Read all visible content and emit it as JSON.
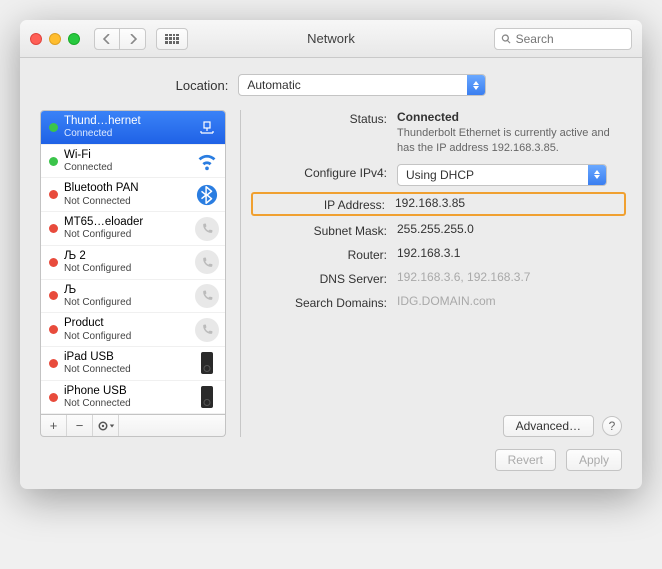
{
  "window": {
    "title": "Network"
  },
  "search": {
    "placeholder": "Search"
  },
  "location": {
    "label": "Location:",
    "value": "Automatic"
  },
  "sidebar": {
    "items": [
      {
        "name": "Thund…hernet",
        "sub": "Connected",
        "status": "green",
        "icon": "ethernet",
        "selected": true
      },
      {
        "name": "Wi-Fi",
        "sub": "Connected",
        "status": "green",
        "icon": "wifi"
      },
      {
        "name": "Bluetooth PAN",
        "sub": "Not Connected",
        "status": "red",
        "icon": "bluetooth"
      },
      {
        "name": "MT65…eloader",
        "sub": "Not Configured",
        "status": "red",
        "icon": "handset"
      },
      {
        "name": "Љ 2",
        "sub": "Not Configured",
        "status": "red",
        "icon": "handset"
      },
      {
        "name": "Љ",
        "sub": "Not Configured",
        "status": "red",
        "icon": "handset"
      },
      {
        "name": "Product",
        "sub": "Not Configured",
        "status": "red",
        "icon": "handset"
      },
      {
        "name": "iPad USB",
        "sub": "Not Connected",
        "status": "red",
        "icon": "slab"
      },
      {
        "name": "iPhone USB",
        "sub": "Not Connected",
        "status": "red",
        "icon": "slab"
      }
    ]
  },
  "detail": {
    "status_label": "Status:",
    "status_value": "Connected",
    "status_desc": "Thunderbolt Ethernet is currently active and has the IP address 192.168.3.85.",
    "cfg_label": "Configure IPv4:",
    "cfg_value": "Using DHCP",
    "ip_label": "IP Address:",
    "ip_value": "192.168.3.85",
    "mask_label": "Subnet Mask:",
    "mask_value": "255.255.255.0",
    "router_label": "Router:",
    "router_value": "192.168.3.1",
    "dns_label": "DNS Server:",
    "dns_value": "192.168.3.6, 192.168.3.7",
    "sd_label": "Search Domains:",
    "sd_value": "IDG.DOMAIN.com",
    "advanced": "Advanced…"
  },
  "footer": {
    "revert": "Revert",
    "apply": "Apply"
  }
}
